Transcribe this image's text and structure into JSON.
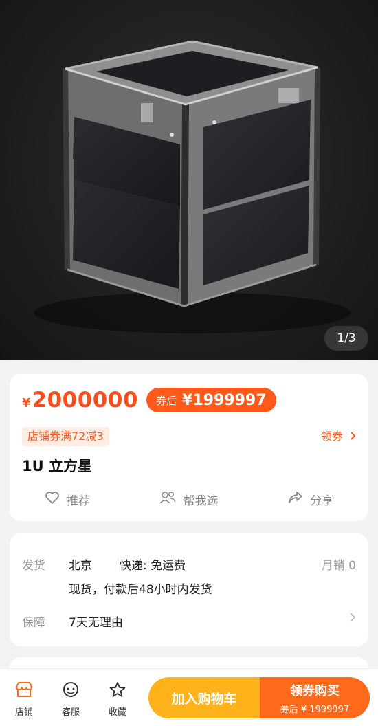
{
  "gallery": {
    "counter": "1/3"
  },
  "product": {
    "currency": "¥",
    "price": "2000000",
    "coupon_tag": "券后",
    "coupon_price": "¥1999997",
    "shop_coupon": "店铺券满72减3",
    "get_coupon": "领券",
    "title": "1U 立方星"
  },
  "actions": [
    {
      "label": "推荐",
      "icon": "heart-icon"
    },
    {
      "label": "帮我选",
      "icon": "people-icon"
    },
    {
      "label": "分享",
      "icon": "share-icon"
    }
  ],
  "shipping": {
    "label": "发货",
    "origin": "北京",
    "express": "快递: 免运费",
    "monthly_sales": "月销 0",
    "stock_note": "现货，付款后48小时内发货"
  },
  "guarantee": {
    "label": "保障",
    "text": "7天无理由"
  },
  "bottom_nav": [
    {
      "label": "店铺",
      "icon": "shop-icon"
    },
    {
      "label": "客服",
      "icon": "service-icon"
    },
    {
      "label": "收藏",
      "icon": "star-icon"
    }
  ],
  "buttons": {
    "add_to_cart": "加入购物车",
    "buy_label": "领券购买",
    "buy_sub": "券后 ¥ 1999997"
  },
  "colors": {
    "accent": "#ff5a1a",
    "cart": "#ffb21a",
    "buy": "#ff6a1a"
  }
}
